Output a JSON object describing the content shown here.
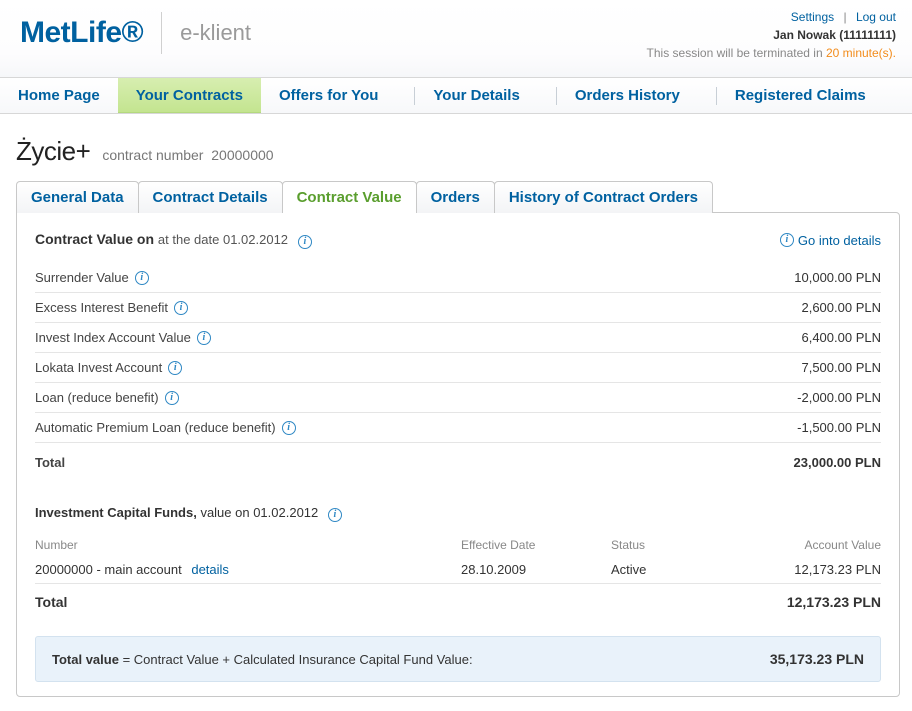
{
  "header": {
    "brand": "MetLife",
    "brand_suffix": "®",
    "subbrand": "e-klient",
    "links": {
      "settings": "Settings",
      "logout": "Log out"
    },
    "user_display": "Jan Nowak (11111111)",
    "session_prefix": "This session will be terminated in ",
    "session_timeout": "20 minute(s)."
  },
  "nav": {
    "items": [
      {
        "label": "Home Page"
      },
      {
        "label": "Your Contracts",
        "active": true
      },
      {
        "label": "Offers for You"
      },
      {
        "label": "Your Details"
      },
      {
        "label": "Orders History"
      },
      {
        "label": "Registered Claims"
      }
    ]
  },
  "page": {
    "product_name": "Życie+",
    "contract_label": "contract number",
    "contract_number": "20000000"
  },
  "subtabs": {
    "items": [
      {
        "label": "General Data"
      },
      {
        "label": "Contract Details"
      },
      {
        "label": "Contract Value",
        "active": true
      },
      {
        "label": "Orders"
      },
      {
        "label": "History of Contract Orders"
      }
    ]
  },
  "contract_value": {
    "title_prefix": "Contract Value on",
    "title_suffix": "at the date 01.02.2012",
    "details_link": "Go into details",
    "rows": [
      {
        "label": "Surrender Value",
        "value": "10,000.00 PLN"
      },
      {
        "label": "Excess Interest Benefit",
        "value": "2,600.00 PLN"
      },
      {
        "label": "Invest Index Account Value",
        "value": "6,400.00 PLN"
      },
      {
        "label": "Lokata Invest Account",
        "value": "7,500.00 PLN"
      },
      {
        "label": "Loan (reduce benefit)",
        "value": "-2,000.00 PLN"
      },
      {
        "label": "Automatic Premium Loan (reduce benefit)",
        "value": "-1,500.00 PLN"
      }
    ],
    "total_label": "Total",
    "total_value": "23,000.00 PLN"
  },
  "funds": {
    "title_prefix": "Investment Capital Funds,",
    "title_suffix": "value on 01.02.2012",
    "columns": {
      "number": "Number",
      "date": "Effective Date",
      "status": "Status",
      "value": "Account Value"
    },
    "rows": [
      {
        "number": "20000000 - main account",
        "details": "details",
        "date": "28.10.2009",
        "status": "Active",
        "value": "12,173.23 PLN"
      }
    ],
    "total_label": "Total",
    "total_value": "12,173.23 PLN"
  },
  "grand_total": {
    "label_bold": "Total value",
    "label_rest": " = Contract Value + Calculated Insurance Capital Fund Value:",
    "value": "35,173.23 PLN"
  }
}
